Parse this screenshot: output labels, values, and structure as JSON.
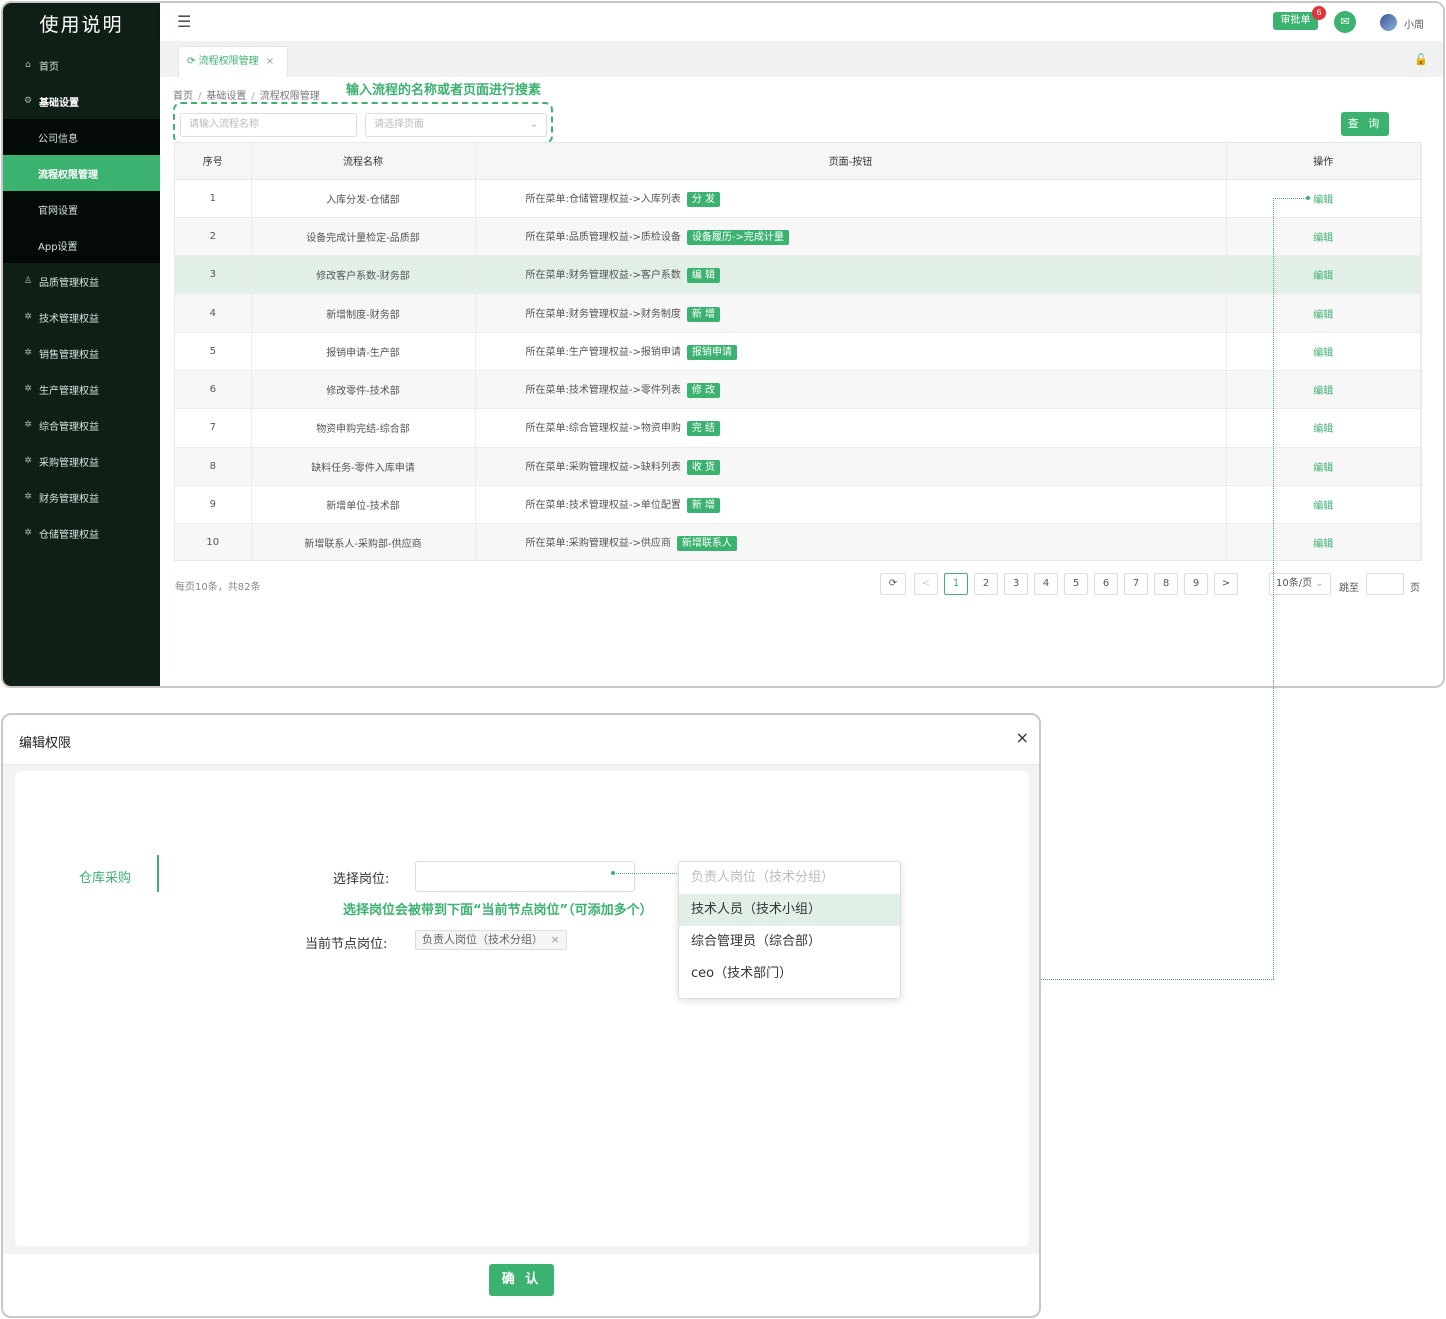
{
  "app": {
    "brand": "使用说明",
    "sidebar": {
      "home": "首页",
      "basic_settings": "基础设置",
      "sub_items": [
        "公司信息",
        "流程权限管理",
        "官网设置",
        "App设置"
      ],
      "groups": [
        "品质管理权益",
        "技术管理权益",
        "销售管理权益",
        "生产管理权益",
        "综合管理权益",
        "采购管理权益",
        "财务管理权益",
        "仓储管理权益"
      ]
    },
    "topbar": {
      "approve_label": "审批单",
      "badge_count": "6",
      "user_name": "小周"
    },
    "tab": {
      "label": "流程权限管理",
      "close": "×"
    },
    "breadcrumb": [
      "首页",
      "基础设置",
      "流程权限管理"
    ],
    "hint_search": "输入流程的名称或者页面进行搜素",
    "search": {
      "name_placeholder": "请输入流程名称",
      "page_placeholder": "请选择页面",
      "query_label": "查 询"
    },
    "table": {
      "headers": [
        "序号",
        "流程名称",
        "页面-按钮",
        "操作"
      ],
      "rows": [
        {
          "no": "1",
          "name": "入库分发-仓储部",
          "path": "所在菜单:仓储管理权益->入库列表",
          "tag": "分 发",
          "action": "编辑"
        },
        {
          "no": "2",
          "name": "设备完成计量检定-品质部",
          "path": "所在菜单:品质管理权益->质检设备",
          "tag": "设备履历->完成计量",
          "action": "编辑"
        },
        {
          "no": "3",
          "name": "修改客户系数-财务部",
          "path": "所在菜单:财务管理权益->客户系数",
          "tag": "编 辑",
          "action": "编辑"
        },
        {
          "no": "4",
          "name": "新增制度-财务部",
          "path": "所在菜单:财务管理权益->财务制度",
          "tag": "新 增",
          "action": "编辑"
        },
        {
          "no": "5",
          "name": "报销申请-生产部",
          "path": "所在菜单:生产管理权益->报销申请",
          "tag": "报销申请",
          "action": "编辑"
        },
        {
          "no": "6",
          "name": "修改零件-技术部",
          "path": "所在菜单:技术管理权益->零件列表",
          "tag": "修 改",
          "action": "编辑"
        },
        {
          "no": "7",
          "name": "物资申购完结-综合部",
          "path": "所在菜单:综合管理权益->物资申购",
          "tag": "完 结",
          "action": "编辑"
        },
        {
          "no": "8",
          "name": "缺料任务-零件入库申请",
          "path": "所在菜单:采购管理权益->缺料列表",
          "tag": "收 货",
          "action": "编辑"
        },
        {
          "no": "9",
          "name": "新增单位-技术部",
          "path": "所在菜单:技术管理权益->单位配置",
          "tag": "新 增",
          "action": "编辑"
        },
        {
          "no": "10",
          "name": "新增联系人-采购部-供应商",
          "path": "所在菜单:采购管理权益->供应商",
          "tag": "新增联系人",
          "action": "编辑"
        }
      ]
    },
    "pagination": {
      "total_text": "每页10条，共82条",
      "prev": "<",
      "next": ">",
      "pages": [
        "1",
        "2",
        "3",
        "4",
        "5",
        "6",
        "7",
        "8",
        "9"
      ],
      "page_size": "10条/页",
      "jump_label": "跳至",
      "page_suffix": "页"
    }
  },
  "modal": {
    "title": "编辑权限",
    "close": "×",
    "left_tab": "仓库采购",
    "select_label": "选择岗位:",
    "hint": "选择岗位会被带到下面“当前节点岗位”（可添加多个）",
    "current_label": "当前节点岗位:",
    "current_chip": "负责人岗位（技术分组）",
    "chip_close": "×",
    "dropdown": [
      "负责人岗位（技术分组）",
      "技术人员（技术小组）",
      "综合管理员（综合部）",
      "ceo（技术部门）"
    ],
    "confirm": "确 认"
  },
  "colors": {
    "accent": "#3cb271",
    "sidebar_bg": "#0f1f16",
    "badge": "#e2323b",
    "highlight_row": "#e2efe6"
  }
}
